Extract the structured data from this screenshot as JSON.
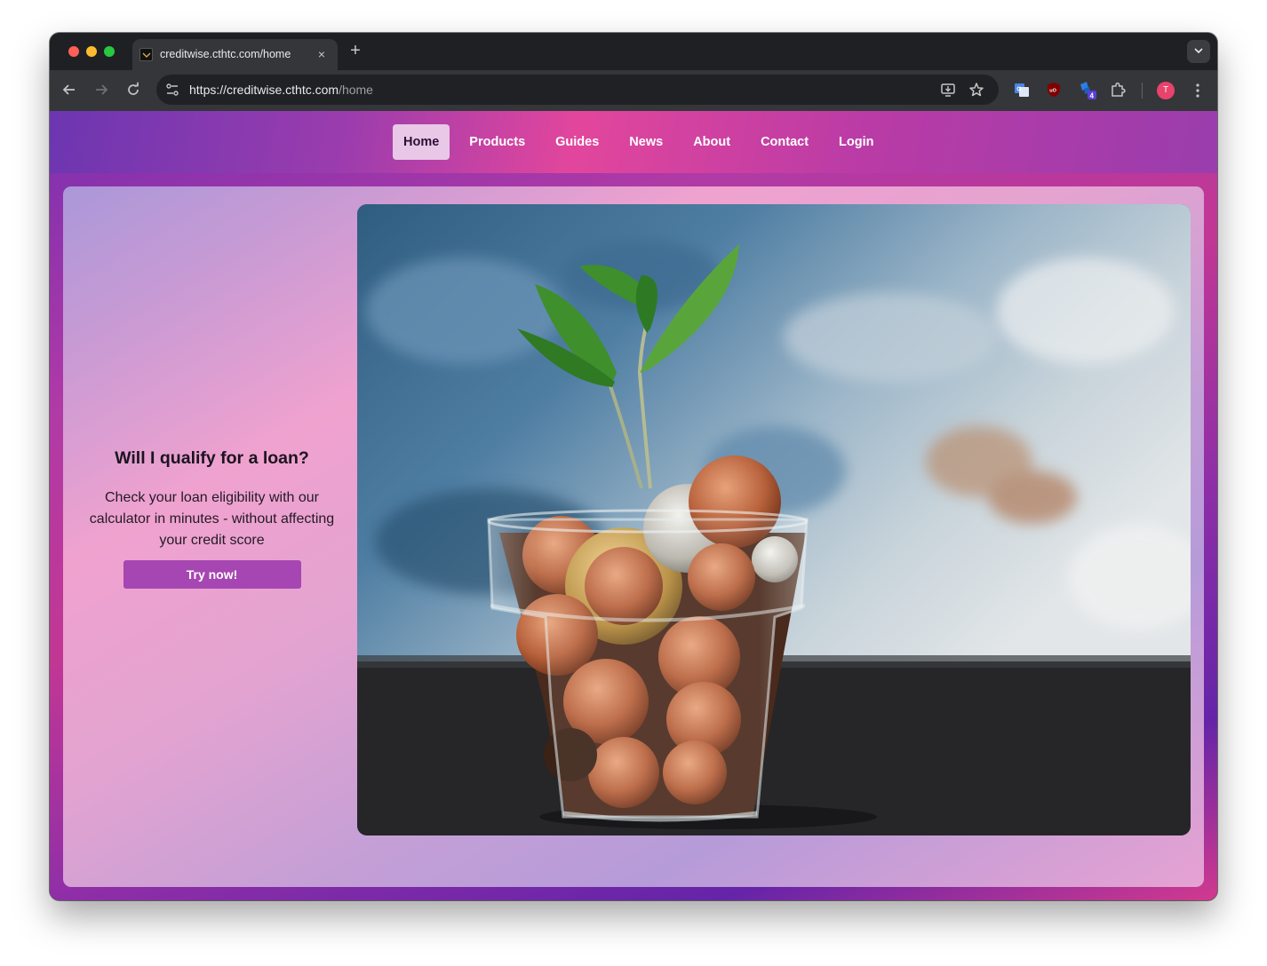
{
  "browser": {
    "tab_title": "creditwise.cthtc.com/home",
    "close_symbol": "×",
    "new_tab_symbol": "+",
    "url_host": "https://creditwise.cthtc.com",
    "url_path": "/home",
    "profile_initial": "T",
    "extension_badge": "4"
  },
  "nav": {
    "items": [
      {
        "label": "Home",
        "active": true
      },
      {
        "label": "Products"
      },
      {
        "label": "Guides"
      },
      {
        "label": "News"
      },
      {
        "label": "About"
      },
      {
        "label": "Contact"
      },
      {
        "label": "Login"
      }
    ]
  },
  "promo": {
    "heading": "Will I qualify for a loan?",
    "body": "Check your loan eligibility with our calculator in minutes - without affecting your credit score",
    "cta_label": "Try now!"
  },
  "colors": {
    "accent_button": "#a646b2",
    "nav_active_bg": "#e8c8e6"
  }
}
